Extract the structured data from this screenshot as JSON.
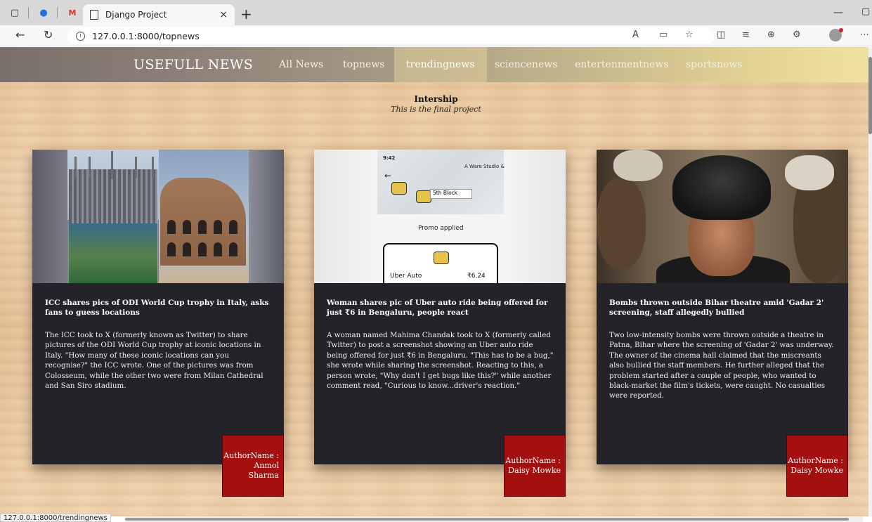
{
  "browser": {
    "tab_title": "Django Project",
    "tab_close": "×",
    "new_tab": "+",
    "url": "127.0.0.1:8000/topnews",
    "status_url": "127.0.0.1:8000/trendingnews"
  },
  "navbar": {
    "brand": "USEFULL NEWS",
    "links": [
      "All News",
      "topnews",
      "trendingnews",
      "sciencenews",
      "entertenmentnews",
      "sportsnews"
    ],
    "active": "trendingnews"
  },
  "hero": {
    "title": "Intership",
    "subtitle": "This is the final project"
  },
  "cards": [
    {
      "headline": "ICC shares pics of ODI World Cup trophy in Italy, asks fans to guess locations",
      "description": "The ICC took to X (formerly known as Twitter) to share pictures of the ODI World Cup trophy at iconic locations in Italy. \"How many of these iconic locations can you recognise?\" the ICC wrote. One of the pictures was from Colosseum, while the other two were from Milan Cathedral and San Siro stadium.",
      "author_label": "AuthorName :",
      "author_name": "Anmol Sharma"
    },
    {
      "headline": "Woman shares pic of Uber auto ride being offered for just ₹6 in Bengaluru, people react",
      "description": "A woman named Mahima Chandak took to X (formerly called Twitter) to post a screenshot showing an Uber auto ride being offered for just ₹6 in Bengaluru. \"This has to be a bug,\" she wrote while sharing the screenshot. Reacting to this, a person wrote, \"Why don't I get bugs like this?\" while another comment read, \"Curious to know...driver's reaction.\"",
      "author_label": "AuthorName :",
      "author_name": "Daisy Mowke",
      "image_text": {
        "promo": "Promo applied",
        "ride": "Uber Auto",
        "price": "₹6.24",
        "block": "5th Block",
        "time": "9:42",
        "place": "A Ware Studio &"
      }
    },
    {
      "headline": "Bombs thrown outside Bihar theatre amid 'Gadar 2' screening, staff allegedly bullied",
      "description": "Two low-intensity bombs were thrown outside a theatre in Patna, Bihar where the screening of 'Gadar 2' was underway. The owner of the cinema hall claimed that the miscreants also bullied the staff members. He further alleged that the problem started after a couple of people, who wanted to black-market the film's tickets, were caught. No casualties were reported.",
      "author_label": "AuthorName :",
      "author_name": "Daisy Mowke"
    }
  ]
}
